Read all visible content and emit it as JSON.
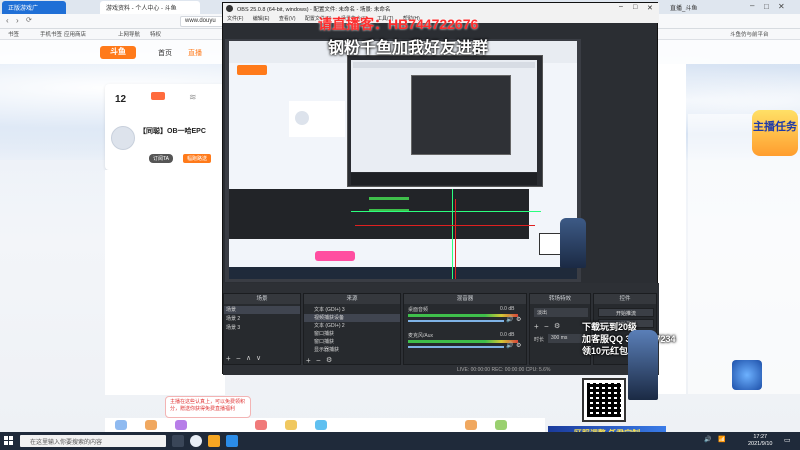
{
  "browser": {
    "tabs": [
      {
        "label": "正版游戏广"
      },
      {
        "label": "游戏资料 - 个人中心 - 斗鱼"
      },
      {
        "label": "直播_斗鱼"
      }
    ],
    "address": "www.douyu",
    "bookmarks": [
      "书签",
      "手机书签",
      "应用商店",
      "上网导航",
      "特权"
    ],
    "bookmark_right": "斗鱼仿与前平台"
  },
  "site": {
    "nav": [
      "首页",
      "直播"
    ],
    "streamer": {
      "count": "12",
      "name": "【同聪】OB一哈EPC",
      "follow_btn": "订阅TA",
      "tag": "幅跑路送"
    }
  },
  "obs": {
    "title": "OBS 25.0.8 (64-bit, windows) - 配置文件: 未命名 - 场景: 未命名",
    "menu": [
      "文件(F)",
      "编辑(E)",
      "查看(V)",
      "配置文件(P)",
      "场景集合(S)",
      "工具(T)",
      "帮助(H)"
    ],
    "scenes_title": "场景",
    "scenes": [
      "场景",
      "场景 2",
      "场景 3"
    ],
    "sources_title": "来源",
    "sources": [
      "文本 (GDI+) 3",
      "视频捕获设备",
      "文本 (GDI+) 2",
      "窗口捕获",
      "窗口捕获",
      "显示器捕获"
    ],
    "mixer_title": "混音器",
    "mixer": [
      {
        "name": "桌面音频",
        "db": "0.0 dB"
      },
      {
        "name": "麦克风/Aux",
        "db": "0.0 dB"
      }
    ],
    "transitions_title": "转场特效",
    "transition_value": "淡出",
    "duration_label": "时长",
    "duration_value": "300 ms",
    "controls_title": "控件",
    "controls": [
      "开始推流",
      "开始录制"
    ],
    "status": "LIVE: 00:00:00   REC: 00:00:00   CPU: 5.6%"
  },
  "overlay": {
    "red_text": "请直播客：HB744722676",
    "white_text": "钢粉千鱼加我好友进群",
    "promo_lines": [
      "下载玩到20级",
      "加客服QQ 3005907234",
      "领10元红包"
    ]
  },
  "right": {
    "task_badge": "主播任务",
    "bottom_banner": "区服调整 任君定制"
  },
  "promo": {
    "text": "主播在这些认真上，可以免费领积分，赠送你获得免费直播福利"
  },
  "taskbar": {
    "search_placeholder": "在这里输入你要搜索的内容",
    "time": "17:27",
    "date": "2021/9/10"
  },
  "colors": {
    "overlay_red": "#ff2d2d",
    "obs_dark": "#2b2e33",
    "taskbar": "#1f2a3a",
    "accent_orange": "#ff7a1a"
  }
}
